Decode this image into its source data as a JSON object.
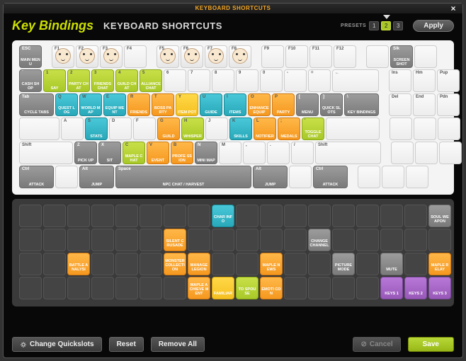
{
  "titlebar": "KEYBOARD SHORTCUTS",
  "header": {
    "logo": "Key Bindings",
    "title": "KEYBOARD SHORTCUTS",
    "presets_label": "PRESETS",
    "presets": [
      "1",
      "2",
      "3"
    ],
    "active_preset": 1,
    "apply": "Apply"
  },
  "keyboard": [
    [
      {
        "k": "ESC",
        "a": "MAIN MENU",
        "c": "gray"
      },
      {
        "gap": 1
      },
      {
        "k": "F1",
        "face": 1
      },
      {
        "k": "F2",
        "face": 1
      },
      {
        "k": "F3",
        "face": 1
      },
      {
        "k": "F4"
      },
      {
        "gap": 1
      },
      {
        "k": "F5",
        "face": 1
      },
      {
        "k": "F6",
        "face": 1
      },
      {
        "k": "F7",
        "face": 1
      },
      {
        "k": "F8",
        "face": 1
      },
      {
        "gap": 1
      },
      {
        "k": "F9"
      },
      {
        "k": "F10"
      },
      {
        "k": "F11"
      },
      {
        "k": "F12"
      },
      {
        "gap": 1
      },
      {
        "k": ""
      },
      {
        "k": "Slk",
        "a": "SCREEN SHOT",
        "c": "gray"
      },
      {
        "k": ""
      }
    ],
    [
      {
        "k": "`",
        "a": "CASH SHOP",
        "c": "gray"
      },
      {
        "k": "1",
        "a": "SAY",
        "c": "lime"
      },
      {
        "k": "2",
        "a": "PARTY CHAT",
        "c": "lime"
      },
      {
        "k": "3",
        "a": "FRIENDS CHAT",
        "c": "lime"
      },
      {
        "k": "4",
        "a": "GUILD CHAT",
        "c": "lime"
      },
      {
        "k": "5",
        "a": "ALLIANCE CHAT",
        "c": "lime"
      },
      {
        "k": "6"
      },
      {
        "k": "7"
      },
      {
        "k": "8"
      },
      {
        "k": "9"
      },
      {
        "k": "0"
      },
      {
        "k": "-"
      },
      {
        "k": "="
      },
      {
        "k": "←",
        "w": "w2"
      },
      {
        "gap": 1
      },
      {
        "k": "Ins"
      },
      {
        "k": "Hm"
      },
      {
        "k": "Pup"
      }
    ],
    [
      {
        "k": "Tab",
        "a": "CYCLE TABS",
        "c": "gray",
        "w": "w15"
      },
      {
        "k": "Q",
        "a": "QUEST LOG",
        "c": "teal"
      },
      {
        "k": "W",
        "a": "WORLD MAP",
        "c": "teal"
      },
      {
        "k": "E",
        "a": "EQUIP MENT",
        "c": "teal"
      },
      {
        "k": "R",
        "a": "FRIENDS",
        "c": "orange"
      },
      {
        "k": "T",
        "a": "BOSS PARTY",
        "c": "orange"
      },
      {
        "k": "Y",
        "a": "ITEM POT",
        "c": "yellow"
      },
      {
        "k": "U",
        "a": "GUIDE",
        "c": "teal"
      },
      {
        "k": "I",
        "a": "ITEMS",
        "c": "teal"
      },
      {
        "k": "O",
        "a": "ENHANCE EQUIP",
        "c": "orange"
      },
      {
        "k": "P",
        "a": "PARTY",
        "c": "orange"
      },
      {
        "k": "[",
        "a": "MENU",
        "c": "gray"
      },
      {
        "k": "]",
        "a": "QUICK SLOTS",
        "c": "gray"
      },
      {
        "k": "\\",
        "a": "KEY BINDINGS",
        "c": "gray",
        "w": "w15"
      },
      {
        "gap": 1
      },
      {
        "k": "Del"
      },
      {
        "k": "End"
      },
      {
        "k": "Pdn"
      }
    ],
    [
      {
        "k": "",
        "w": "w175"
      },
      {
        "k": "A"
      },
      {
        "k": "S",
        "a": "STATS",
        "c": "teal"
      },
      {
        "k": "D"
      },
      {
        "k": "F"
      },
      {
        "k": "G",
        "a": "GUILD",
        "c": "orange"
      },
      {
        "k": "H",
        "a": "WHISPER",
        "c": "lime"
      },
      {
        "k": "J"
      },
      {
        "k": "K",
        "a": "SKILLS",
        "c": "teal"
      },
      {
        "k": "L",
        "a": "NOTIFIER",
        "c": "orange"
      },
      {
        "k": ";",
        "a": "MEDALS",
        "c": "orange"
      },
      {
        "k": "'",
        "a": "TOGGLE CHAT",
        "c": "lime"
      },
      {
        "k": "",
        "w": "w225"
      },
      {
        "gap": 1
      },
      {
        "k": ""
      },
      {
        "k": ""
      },
      {
        "k": ""
      }
    ],
    [
      {
        "k": "Shift",
        "w": "w225"
      },
      {
        "k": "Z",
        "a": "PICK UP",
        "c": "gray"
      },
      {
        "k": "X",
        "a": "SIT",
        "c": "gray"
      },
      {
        "k": "C",
        "a": "MAPLE CHAT",
        "c": "lime"
      },
      {
        "k": "V",
        "a": "EVENT",
        "c": "orange"
      },
      {
        "k": "B",
        "a": "PROFE SSION",
        "c": "orange"
      },
      {
        "k": "N",
        "a": "MINI MAP",
        "c": "gray"
      },
      {
        "k": "M"
      },
      {
        "k": ","
      },
      {
        "k": "."
      },
      {
        "k": "/"
      },
      {
        "k": "Shift",
        "w": "w275"
      },
      {
        "gap": 1
      },
      {
        "k": ""
      },
      {
        "k": ""
      },
      {
        "k": ""
      }
    ],
    [
      {
        "k": "Ctrl",
        "a": "ATTACK",
        "c": "gray",
        "w": "w15"
      },
      {
        "k": ""
      },
      {
        "k": "Alt",
        "a": "JUMP",
        "c": "gray",
        "w": "w15"
      },
      {
        "k": "Space",
        "a": "NPC CHAT / HARVEST",
        "c": "gray",
        "w": "w6"
      },
      {
        "k": "Alt",
        "a": "JUMP",
        "c": "gray",
        "w": "w15"
      },
      {
        "k": ""
      },
      {
        "k": "Ctrl",
        "a": "ATTACK",
        "c": "gray",
        "w": "w15"
      },
      {
        "gap": 1
      },
      {
        "k": ""
      },
      {
        "k": ""
      },
      {
        "k": ""
      }
    ]
  ],
  "unbound": [
    [
      null,
      null,
      null,
      null,
      null,
      null,
      null,
      null,
      {
        "a": "CHAR INFO",
        "c": "teal"
      },
      null,
      null,
      null,
      null,
      null,
      null,
      null,
      null,
      {
        "a": "SOUL WEAPON",
        "c": "gray"
      }
    ],
    [
      null,
      null,
      null,
      null,
      null,
      null,
      {
        "a": "SILENT CRUSADE",
        "c": "orange"
      },
      null,
      null,
      null,
      null,
      null,
      {
        "a": "CHANGE CHANNEL",
        "c": "gray"
      },
      null,
      null,
      null,
      null,
      null
    ],
    [
      null,
      null,
      {
        "a": "BATTLE ANALYSI",
        "c": "orange"
      },
      null,
      null,
      null,
      {
        "a": "MONSTER COLLECTION",
        "c": "orange"
      },
      {
        "a": "MANAGE LEGION",
        "c": "orange"
      },
      null,
      null,
      {
        "a": "MAPLE NEWS",
        "c": "orange"
      },
      null,
      null,
      {
        "a": "PICTURE MODE",
        "c": "gray"
      },
      null,
      {
        "a": "MUTE",
        "c": "gray"
      },
      null,
      {
        "a": "MAPLE RELAY",
        "c": "orange"
      }
    ],
    [
      null,
      null,
      null,
      null,
      null,
      null,
      null,
      {
        "a": "MAPLE ACHIEVE MENT",
        "c": "orange"
      },
      {
        "a": "FAMILIAR",
        "c": "yellow"
      },
      {
        "a": "TO SPOUSE",
        "c": "lime"
      },
      {
        "a": "EMOTI CON",
        "c": "orange"
      },
      null,
      null,
      null,
      null,
      {
        "a": "KEYS 1",
        "c": "purple"
      },
      {
        "a": "KEYS 2",
        "c": "purple"
      },
      {
        "a": "KEYS 3",
        "c": "purple"
      }
    ]
  ],
  "footer": {
    "quickslots": "Change Quickslots",
    "reset": "Reset",
    "removeall": "Remove All",
    "cancel": "Cancel",
    "save": "Save"
  }
}
